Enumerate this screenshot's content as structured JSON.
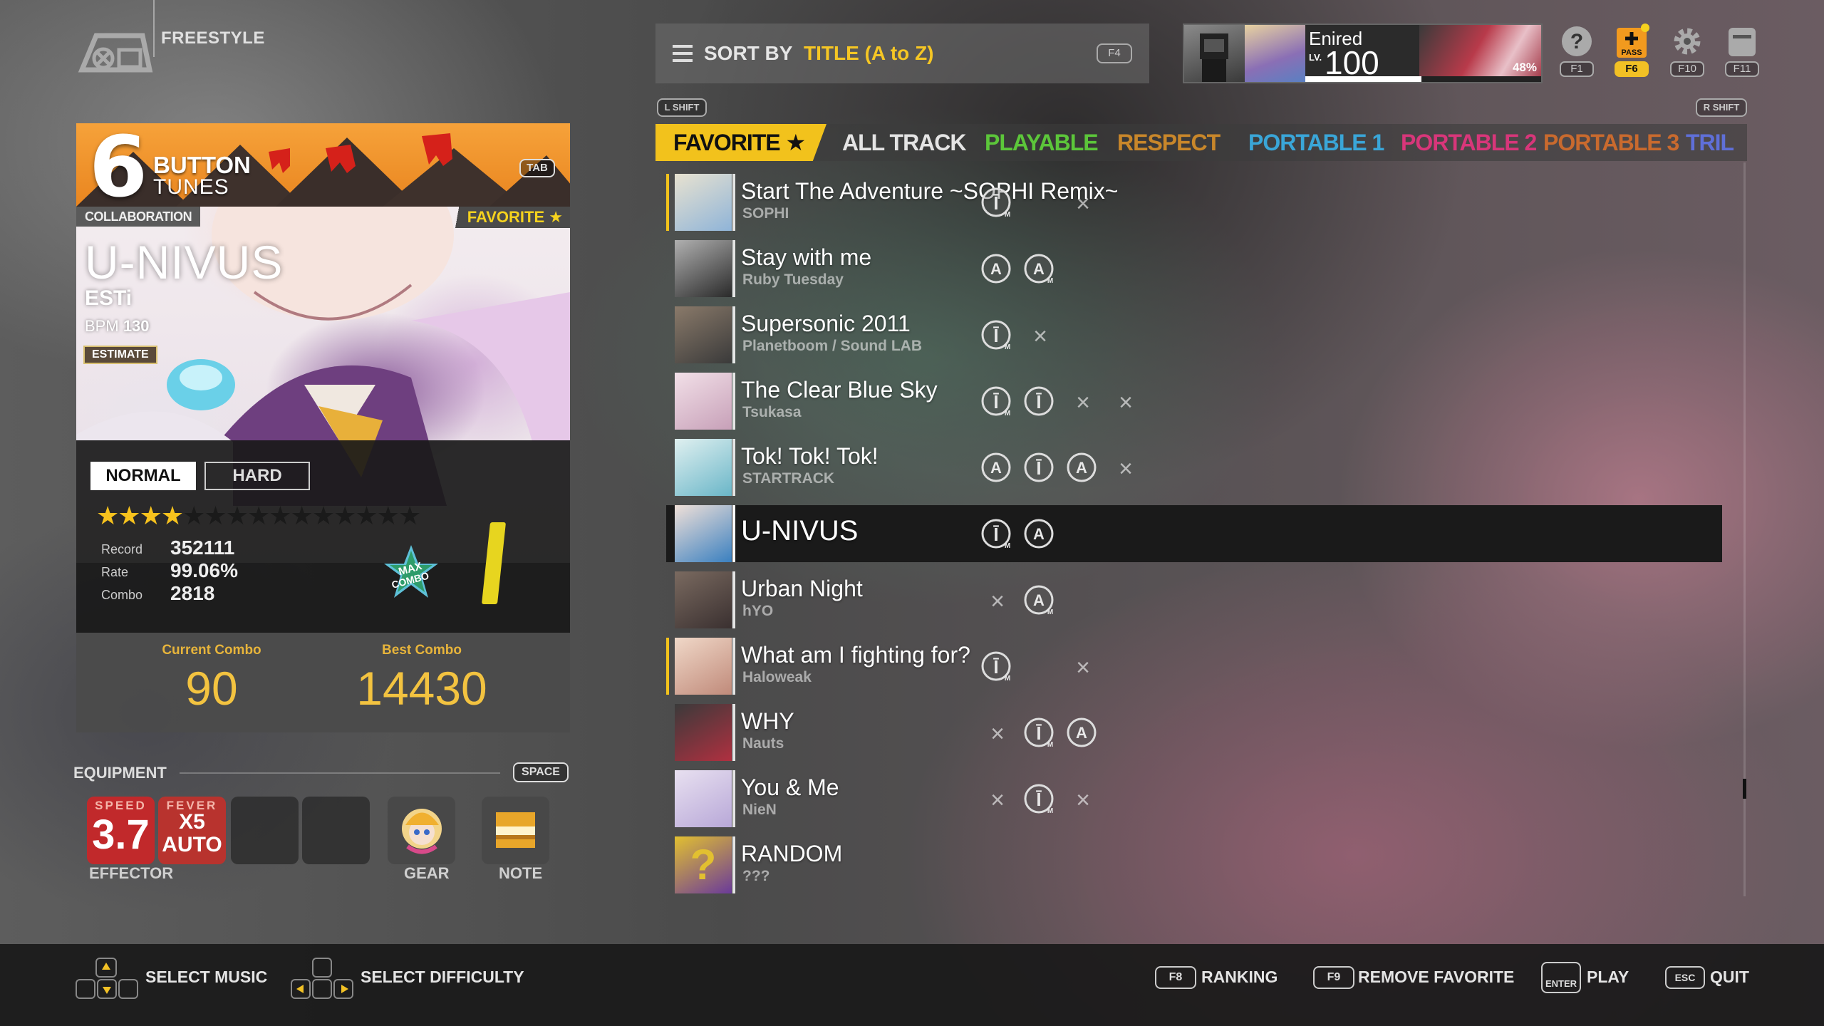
{
  "mode": "FREESTYLE",
  "sort": {
    "label": "SORT BY",
    "value": "TITLE (A to Z)",
    "key": "F4"
  },
  "profile": {
    "name": "Enired",
    "lv_label": "LV.",
    "level": "100",
    "progress_pct": "48%",
    "progress": 0.48
  },
  "top_keys": {
    "help": "F1",
    "pass": "F6",
    "settings": "F10",
    "exit": "F11",
    "pass_label": "PASS"
  },
  "shift_keys": {
    "left": "L SHIFT",
    "right": "R SHIFT"
  },
  "categories": [
    {
      "label": "FAVORITE ★",
      "color": "#111111"
    },
    {
      "label": "ALL TRACK",
      "color": "#e4e4e4"
    },
    {
      "label": "PLAYABLE",
      "color": "#5cc63a"
    },
    {
      "label": "RESPECT",
      "color": "#c9872a"
    },
    {
      "label": "PORTABLE 1",
      "color": "#3aa6d8"
    },
    {
      "label": "PORTABLE 2",
      "color": "#d8367a"
    },
    {
      "label": "PORTABLE 3",
      "color": "#c96a2e"
    },
    {
      "label": "TRIL",
      "color": "#5f6fd8"
    }
  ],
  "card": {
    "buttons": "6",
    "button_word": "BUTTON",
    "tunes_word": "TUNES",
    "tab_key": "TAB",
    "collab_tag": "COLLABORATION",
    "favorite_tag": "FAVORITE ★",
    "title": "U-NIVUS",
    "artist": "ESTi",
    "bpm_label": "BPM",
    "bpm": "130",
    "estimate": "ESTIMATE",
    "difficulties": [
      "NORMAL",
      "HARD"
    ],
    "stars_on": 4,
    "stars_total": 15,
    "record_label": "Record",
    "record": "352111",
    "rate_label": "Rate",
    "rate": "99.06%",
    "combo_label": "Combo",
    "combo": "2818",
    "max_combo_badge": "MAX COMBO",
    "current_combo_label": "Current Combo",
    "current_combo": "90",
    "best_combo_label": "Best Combo",
    "best_combo": "14430"
  },
  "equipment": {
    "label": "EQUIPMENT",
    "key": "SPACE",
    "speed_label": "SPEED",
    "speed": "3.7",
    "fever_label": "FEVER",
    "fever_x": "X5",
    "fever_mode": "AUTO",
    "effector": "EFFECTOR",
    "gear": "GEAR",
    "note": "NOTE"
  },
  "songs": [
    {
      "title": "Start The Adventure ~SOPHI Remix~",
      "artist": "SOPHI",
      "accent": "#f2c21c",
      "thumb": [
        "#8fb4d8",
        "#e8e2d0"
      ],
      "badges": [
        "M",
        "",
        "x"
      ]
    },
    {
      "title": "Stay with me",
      "artist": "Ruby Tuesday",
      "accent": "",
      "thumb": [
        "#2a2a2a",
        "#b0b0b0"
      ],
      "badges": [
        "A",
        "AM"
      ]
    },
    {
      "title": "Supersonic 2011",
      "artist": "Planetboom / Sound LAB",
      "accent": "",
      "thumb": [
        "#3a3a3a",
        "#8a7a6a"
      ],
      "badges": [
        "M",
        "x"
      ]
    },
    {
      "title": "The Clear Blue Sky",
      "artist": "Tsukasa",
      "accent": "",
      "thumb": [
        "#c7a0b8",
        "#f2e0e8"
      ],
      "badges": [
        "M",
        "P",
        "x",
        "x"
      ]
    },
    {
      "title": "Tok! Tok! Tok!",
      "artist": "STARTRACK",
      "accent": "",
      "thumb": [
        "#6ab6c8",
        "#e0f0f0"
      ],
      "badges": [
        "A",
        "P",
        "A",
        "x"
      ]
    },
    {
      "title": "U-NIVUS",
      "artist": "",
      "accent": "",
      "thumb": [
        "#3a80c0",
        "#f0e0d8"
      ],
      "badges": [
        "M",
        "A"
      ],
      "selected": true
    },
    {
      "title": "Urban Night",
      "artist": "hYO",
      "accent": "",
      "thumb": [
        "#3a3030",
        "#7a6a60"
      ],
      "badges": [
        "x",
        "AM"
      ]
    },
    {
      "title": "What am I fighting for?",
      "artist": "Haloweak",
      "accent": "#f2c21c",
      "thumb": [
        "#c08a7a",
        "#f0d8c8"
      ],
      "badges": [
        "M",
        "",
        "x"
      ]
    },
    {
      "title": "WHY",
      "artist": "Nauts",
      "accent": "",
      "thumb": [
        "#b03040",
        "#3a3a3a"
      ],
      "badges": [
        "x",
        "M",
        "A"
      ]
    },
    {
      "title": "You & Me",
      "artist": "NieN",
      "accent": "",
      "thumb": [
        "#b8a8d8",
        "#e8e0f0"
      ],
      "badges": [
        "x",
        "M",
        "x"
      ]
    },
    {
      "title": "RANDOM",
      "artist": "???",
      "accent": "",
      "thumb": [
        "#6a3a9a",
        "#e2c030"
      ],
      "badges": []
    }
  ],
  "hints": {
    "select_music": "SELECT MUSIC",
    "select_difficulty": "SELECT DIFFICULTY",
    "ranking_key": "F8",
    "ranking": "RANKING",
    "remove_key": "F9",
    "remove_favorite": "REMOVE FAVORITE",
    "play_key": "ENTER",
    "play": "PLAY",
    "quit_key": "ESC",
    "quit": "QUIT"
  }
}
